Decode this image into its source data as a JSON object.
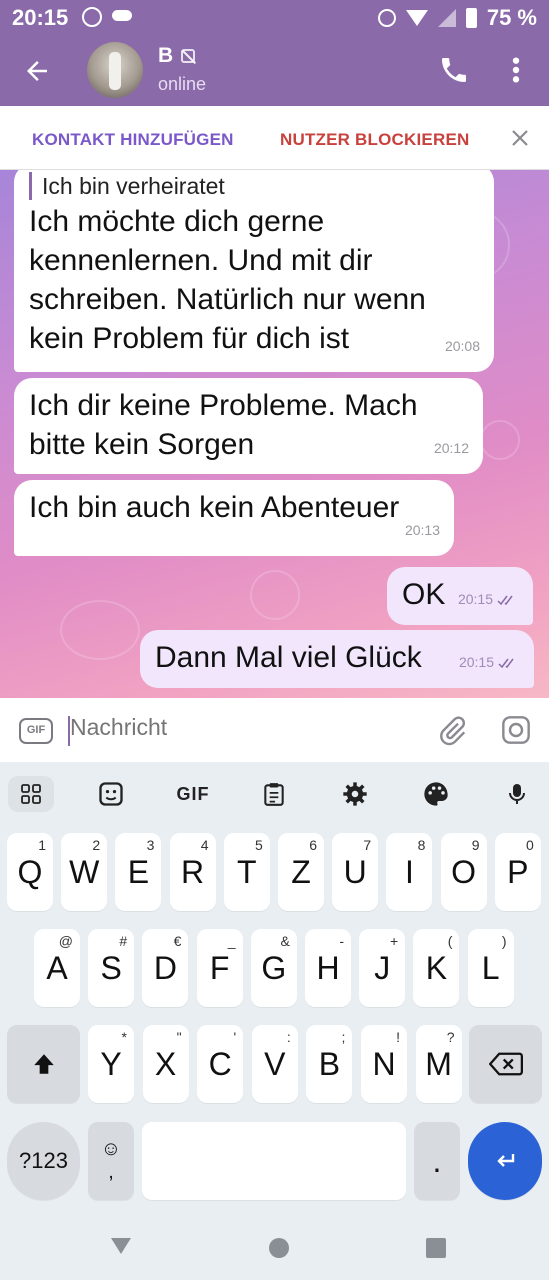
{
  "status_bar": {
    "time": "20:15",
    "battery": "75 %"
  },
  "header": {
    "contact_name": "B",
    "status": "online"
  },
  "action_bar": {
    "add_contact": "KONTAKT HINZUFÜGEN",
    "block_user": "NUTZER BLOCKIEREN"
  },
  "messages": [
    {
      "quote": "Ich bin verheiratet",
      "text": "Ich möchte dich gerne kennenlernen. Und mit dir schreiben. Natürlich nur wenn kein Problem für dich ist",
      "time": "20:08"
    },
    {
      "text": "Ich dir keine Probleme. Mach bitte kein Sorgen",
      "time": "20:12"
    },
    {
      "text": "Ich bin auch kein Abenteuer",
      "time": "20:13"
    },
    {
      "text": "OK",
      "time": "20:15"
    },
    {
      "text": "Dann Mal viel Glück",
      "time": "20:15"
    }
  ],
  "input": {
    "placeholder": "Nachricht",
    "gif_label": "GIF"
  },
  "keyboard": {
    "tool_gif": "GIF",
    "row1": [
      {
        "key": "Q",
        "hint": "1"
      },
      {
        "key": "W",
        "hint": "2"
      },
      {
        "key": "E",
        "hint": "3"
      },
      {
        "key": "R",
        "hint": "4"
      },
      {
        "key": "T",
        "hint": "5"
      },
      {
        "key": "Z",
        "hint": "6"
      },
      {
        "key": "U",
        "hint": "7"
      },
      {
        "key": "I",
        "hint": "8"
      },
      {
        "key": "O",
        "hint": "9"
      },
      {
        "key": "P",
        "hint": "0"
      }
    ],
    "row2": [
      {
        "key": "A",
        "hint": "@"
      },
      {
        "key": "S",
        "hint": "#"
      },
      {
        "key": "D",
        "hint": "€"
      },
      {
        "key": "F",
        "hint": "_"
      },
      {
        "key": "G",
        "hint": "&"
      },
      {
        "key": "H",
        "hint": "-"
      },
      {
        "key": "J",
        "hint": "+"
      },
      {
        "key": "K",
        "hint": "("
      },
      {
        "key": "L",
        "hint": ")"
      }
    ],
    "row3": [
      {
        "key": "Y",
        "hint": "*"
      },
      {
        "key": "X",
        "hint": "\""
      },
      {
        "key": "C",
        "hint": "'"
      },
      {
        "key": "V",
        "hint": ":"
      },
      {
        "key": "B",
        "hint": ";"
      },
      {
        "key": "N",
        "hint": "!"
      },
      {
        "key": "M",
        "hint": "?"
      }
    ],
    "symbols_key": "?123",
    "emoji_key_glyph": "☺",
    "comma": ",",
    "period": "."
  },
  "colors": {
    "header": "#8a6aa8",
    "accent": "#7b58c9",
    "danger": "#c9413d",
    "enter": "#2b63d6"
  }
}
